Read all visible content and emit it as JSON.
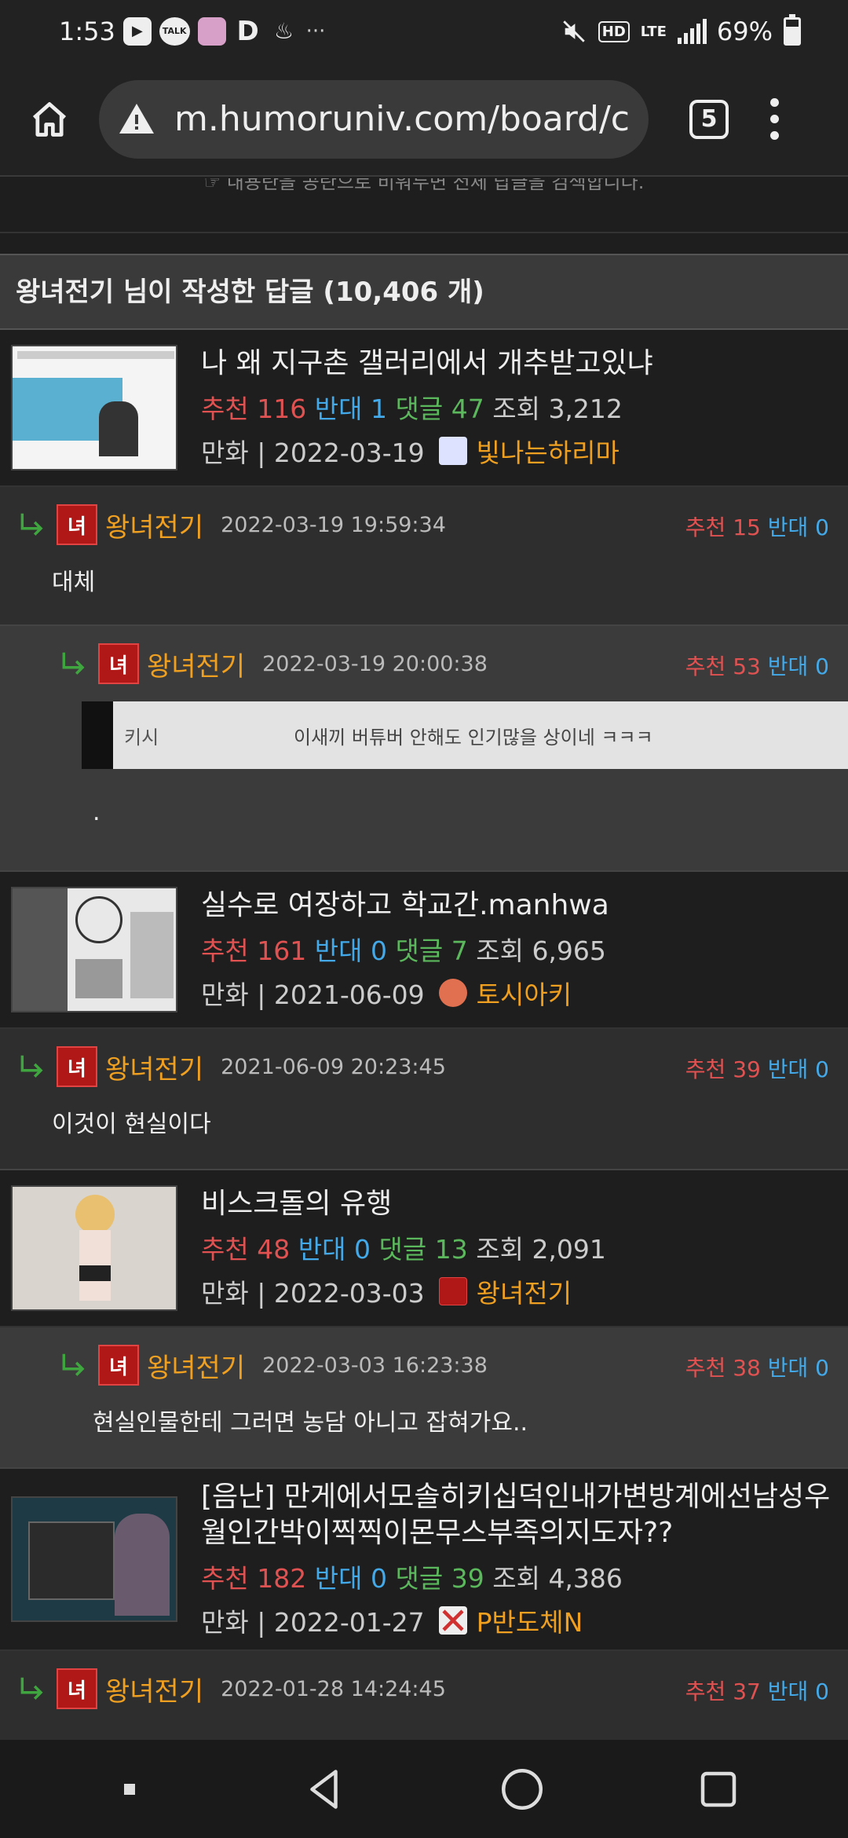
{
  "status_bar": {
    "time": "1:53",
    "d_label": "D",
    "dots": "···",
    "hd_label": "HD",
    "lte_label": "LTE",
    "battery_percent": "69%",
    "battery_level": 0.69,
    "talk_label": "TALK"
  },
  "browser": {
    "url": "m.humoruniv.com/board/cor",
    "tab_count": "5"
  },
  "notice": "☞ 내용란을 공란으로 비워두면 전체 답글을 검색합니다.",
  "section_title": "왕녀전기 님이 작성한 답글 (10,406 개)",
  "labels": {
    "rec": "추천",
    "opp": "반대",
    "cmt": "댓글",
    "view": "조회",
    "sep": "|"
  },
  "posts": [
    {
      "title": "나 왜 지구촌 갤러리에서 개추받고있냐",
      "rec": "116",
      "opp": "1",
      "cmt": "47",
      "view": "3,212",
      "category": "만화",
      "date": "2022-03-19",
      "author": "빛나는하리마"
    },
    {
      "title": "실수로 여장하고 학교간.manhwa",
      "rec": "161",
      "opp": "0",
      "cmt": "7",
      "view": "6,965",
      "category": "만화",
      "date": "2021-06-09",
      "author": "토시아키"
    },
    {
      "title": "비스크돌의 유행",
      "rec": "48",
      "opp": "0",
      "cmt": "13",
      "view": "2,091",
      "category": "만화",
      "date": "2022-03-03",
      "author": "왕녀전기"
    },
    {
      "title_line1": "[음난] 만게에서모솔히키십덕인내가변방계에선남성우",
      "title_line2": "월인간박이찍찍이몬무스부족의지도자??",
      "rec": "182",
      "opp": "0",
      "cmt": "39",
      "view": "4,386",
      "category": "만화",
      "date": "2022-01-27",
      "author": "P반도체N"
    }
  ],
  "replies": [
    {
      "name": "왕녀전기",
      "date": "2022-03-19 19:59:34",
      "rec": "15",
      "opp": "0",
      "text": "대체"
    },
    {
      "name": "왕녀전기",
      "date": "2022-03-19 20:00:38",
      "rec": "53",
      "opp": "0",
      "text": ".",
      "image_name": "키시",
      "image_text": "이새끼 버튜버 안해도 인기많을 상이네 ㅋㅋㅋ"
    },
    {
      "name": "왕녀전기",
      "date": "2021-06-09 20:23:45",
      "rec": "39",
      "opp": "0",
      "text": "이것이 현실이다"
    },
    {
      "name": "왕녀전기",
      "date": "2022-03-03 16:23:38",
      "rec": "38",
      "opp": "0",
      "text": "현실인물한테 그러면 농담 아니고 잡혀가요.."
    },
    {
      "name": "왕녀전기",
      "date": "2022-01-28 14:24:45",
      "rec": "37",
      "opp": "0"
    }
  ],
  "avatar_glyph": "녀",
  "colors": {
    "rec": "#e05252",
    "opp": "#43a9e8",
    "cmt": "#5cb85c",
    "author": "#f0a020"
  },
  "icons": {
    "home": "home-icon",
    "warning": "warning-icon",
    "tabs": "tabs-icon",
    "menu": "more-vert-icon",
    "reply_arrow": "reply-arrow-icon",
    "nav_back": "back-icon",
    "nav_home": "home-circle-icon",
    "nav_recents": "recents-icon"
  }
}
